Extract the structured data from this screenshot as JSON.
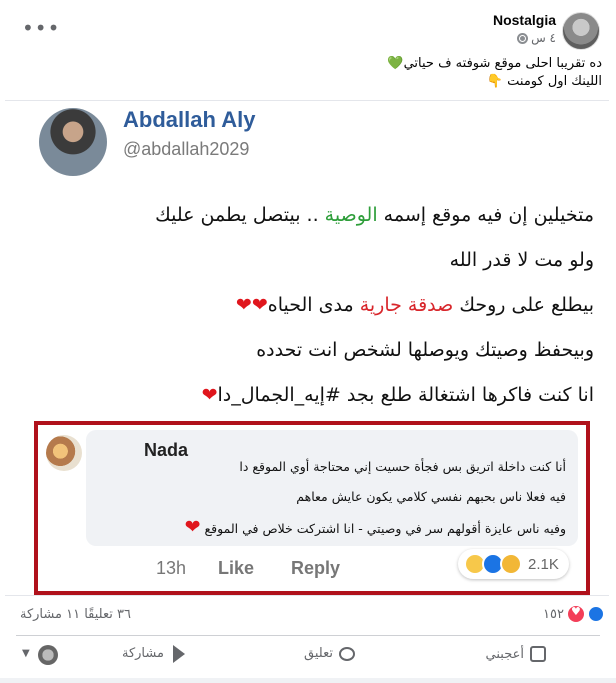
{
  "post": {
    "page_name": "Nostalgia",
    "time": "٤ س",
    "more_icon": "more-dots-icon",
    "caption_line1": "ده تقريبا احلى موقع شوفته ف حياتي",
    "caption_line2": "اللينك اول كومنت",
    "caption_emoji1": "💚",
    "caption_emoji2": "👇"
  },
  "tweet": {
    "name": "Abdallah Aly",
    "handle": "@abdallah2029",
    "line1_a": "متخيلين إن فيه موقع إسمه ",
    "line1_green": "الوصية",
    "line1_b": " .. بيتصل يطمن عليك",
    "line2": "ولو مت لا قدر الله",
    "line3_a": "بيطلع على روحك ",
    "line3_red": "صدقة جارية",
    "line3_b": " مدى الحياه",
    "line3_hearts": "❤❤",
    "line4": "وبيحفظ وصيتك ويوصلها لشخص انت تحدده",
    "line5": "انا كنت فاكرها اشتغالة طلع بجد #إيه_الجمال_دا",
    "line5_heart": "❤"
  },
  "comment": {
    "author": "Nada",
    "line1": "أنا كنت داخلة اتريق بس فجأة حسيت إني محتاجة أوي الموقع دا",
    "line2": "فيه فعلا ناس بحبهم نفسي كلامي يكون عايش معاهم",
    "line3": "وفيه ناس عايزة أقولهم سر في وصيتي - انا اشتركت خلاص في الموقع",
    "heart": "❤",
    "time": "13h",
    "like": "Like",
    "reply": "Reply",
    "reactions_count": "2.1K"
  },
  "footer": {
    "reactions_count": "١٥٢",
    "comments_shares": "٣٦ تعليقًا ١١ مشاركة",
    "like_label": "أعجبني",
    "comment_label": "تعليق",
    "share_label": "مشاركة"
  },
  "colors": {
    "accent_blue": "#1b74e4",
    "frame_red": "#b0111b",
    "green_text": "#2e9e3a",
    "red_text": "#d8262b"
  }
}
